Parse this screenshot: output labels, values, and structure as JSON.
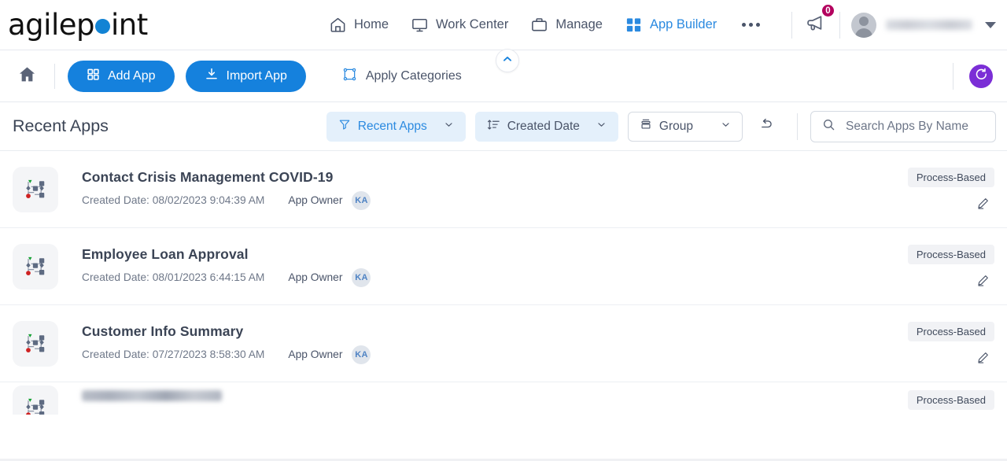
{
  "brand": {
    "logo_text_part1": "agilep",
    "logo_text_part2": "int",
    "accent_blue": "#1283d4",
    "purple": "#7b2ed6",
    "badge_magenta": "#b3005e"
  },
  "header": {
    "nav": [
      {
        "label": "Home",
        "icon": "home-icon",
        "active": false
      },
      {
        "label": "Work Center",
        "icon": "monitor-icon",
        "active": false
      },
      {
        "label": "Manage",
        "icon": "briefcase-icon",
        "active": false
      },
      {
        "label": "App Builder",
        "icon": "grid-icon",
        "active": true
      }
    ],
    "more_menu": "more-options-icon",
    "notification": {
      "icon": "megaphone-icon",
      "count": "0"
    },
    "user": {
      "avatar": "user-avatar",
      "name": "",
      "caret": "chevron-down-icon"
    },
    "collapse_toggle": "chevron-up-icon"
  },
  "toolbar": {
    "home_icon": "home-solid-icon",
    "add_app_label": "Add App",
    "import_app_label": "Import App",
    "apply_categories_label": "Apply Categories",
    "refresh_icon": "refresh-icon"
  },
  "filters": {
    "page_title": "Recent Apps",
    "filter_chip": {
      "label": "Recent Apps",
      "icon": "filter-icon"
    },
    "sort_chip": {
      "label": "Created Date",
      "icon": "sort-icon"
    },
    "group_chip": {
      "label": "Group",
      "icon": "group-icon"
    },
    "reset_icon": "undo-icon",
    "search": {
      "icon": "search-icon",
      "value": "",
      "placeholder": "Search Apps By Name"
    }
  },
  "apps": [
    {
      "icon": "process-flow-icon",
      "name": "Contact Crisis Management COVID-19",
      "created_date": "Created Date: 08/02/2023 9:04:39 AM",
      "owner_label": "App Owner",
      "owner_initials": "KA",
      "tag": "Process-Based",
      "edit_icon": "pencil-icon"
    },
    {
      "icon": "process-flow-icon",
      "name": "Employee Loan Approval",
      "created_date": "Created Date: 08/01/2023 6:44:15 AM",
      "owner_label": "App Owner",
      "owner_initials": "KA",
      "tag": "Process-Based",
      "edit_icon": "pencil-icon"
    },
    {
      "icon": "process-flow-icon",
      "name": "Customer Info Summary",
      "created_date": "Created Date: 07/27/2023 8:58:30 AM",
      "owner_label": "App Owner",
      "owner_initials": "KA",
      "tag": "Process-Based",
      "edit_icon": "pencil-icon"
    },
    {
      "icon": "process-flow-icon",
      "name": "",
      "created_date": "",
      "owner_label": "",
      "owner_initials": "",
      "tag": "Process-Based",
      "edit_icon": "pencil-icon"
    }
  ]
}
